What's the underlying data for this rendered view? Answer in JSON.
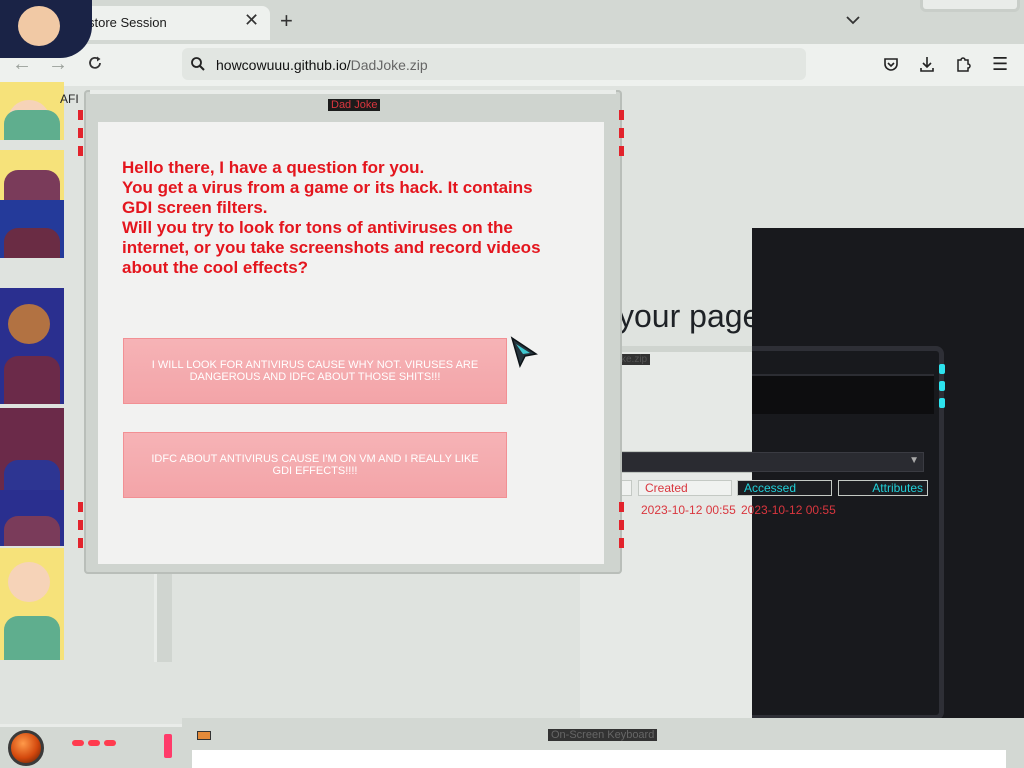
{
  "browser": {
    "tab_title": "store Session",
    "url_host": "howcowuuu.github.io/",
    "url_path": "DadJoke.zip",
    "icons": {
      "back": "arrow-left-icon",
      "forward": "arrow-right-icon",
      "reload": "reload-icon",
      "new_tab": "plus-icon",
      "close": "close-icon",
      "tab_list": "chevron-down-icon",
      "pocket": "pocket-icon",
      "download": "download-icon",
      "extensions": "puzzle-icon",
      "menu": "hamburger-icon"
    }
  },
  "page": {
    "afi_fragment": "AFI",
    "headline": "your pages back."
  },
  "explorer": {
    "title_fragment": "ke.zip",
    "columns": [
      "Created",
      "Accessed",
      "Attributes"
    ],
    "created_value": "2023-10-12 00:55",
    "accessed_value": "2023-10-12 00:55"
  },
  "dialog": {
    "title": "Dad Joke",
    "question_lines": [
      "Hello there, I have a question for you.",
      "You get a virus from a game or its hack. It contains",
      "GDI screen filters.",
      "Will you try to look for tons of antiviruses on the",
      "internet, or you take screenshots and record videos",
      "about the cool effects?"
    ],
    "choice_1": "I WILL LOOK FOR ANTIVIRUS CAUSE WHY NOT. VIRUSES ARE DANGEROUS AND IDFC ABOUT THOSE SHITS!!!",
    "choice_2": "IDFC ABOUT ANTIVIRUS CAUSE I'M ON VM AND I REALLY LIKE GDI EFFECTS!!!!"
  },
  "bottom": {
    "osk_title": "On-Screen Keyboard"
  },
  "colors": {
    "accent_red": "#e4161e",
    "button_pink": "#f6b3b6",
    "cyan": "#21d0d8",
    "dark_panel": "#18191d"
  }
}
